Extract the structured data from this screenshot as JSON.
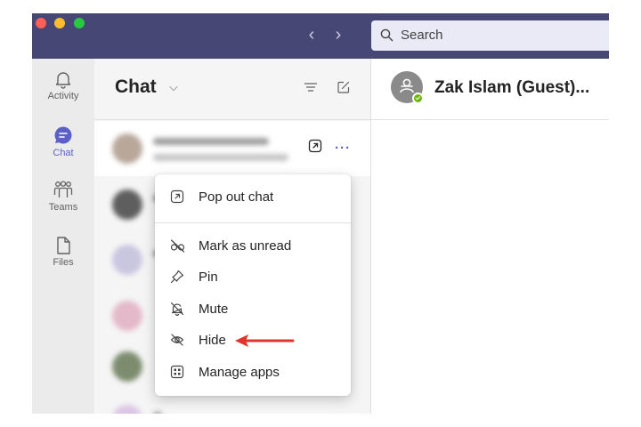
{
  "titlebar": {
    "nav_back": "‹",
    "nav_forward": "›",
    "search_placeholder": "Search"
  },
  "rail": {
    "items": [
      {
        "label": "Activity",
        "icon": "bell-icon"
      },
      {
        "label": "Chat",
        "icon": "chat-bubble-icon",
        "active": true
      },
      {
        "label": "Teams",
        "icon": "teams-icon"
      },
      {
        "label": "Files",
        "icon": "file-icon"
      }
    ]
  },
  "chatlist": {
    "title": "Chat",
    "caret": "⌵",
    "more": "···"
  },
  "conversation": {
    "name": "Zak Islam (Guest)..."
  },
  "context_menu": {
    "items": [
      {
        "label": "Pop out chat",
        "icon": "popout-icon"
      },
      {
        "label": "Mark as unread",
        "icon": "glasses-off-icon"
      },
      {
        "label": "Pin",
        "icon": "pin-icon"
      },
      {
        "label": "Mute",
        "icon": "bell-off-icon"
      },
      {
        "label": "Hide",
        "icon": "eye-off-icon"
      },
      {
        "label": "Manage apps",
        "icon": "apps-grid-icon"
      }
    ]
  },
  "colors": {
    "titlebar": "#464775",
    "accent": "#5b5fc7",
    "annotation_arrow": "#e0352b",
    "presence": "#6bb700"
  }
}
